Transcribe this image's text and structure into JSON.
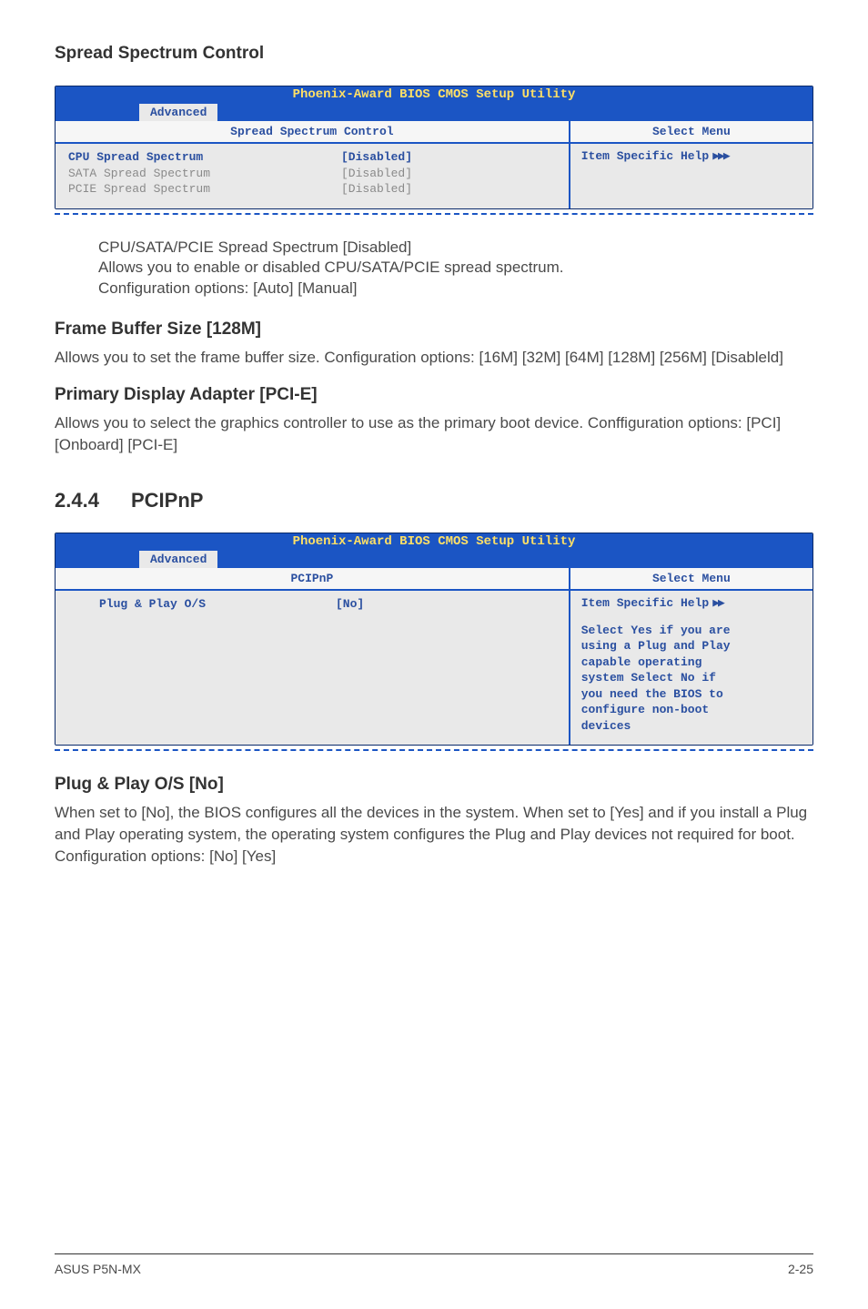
{
  "sections": {
    "spread_spectrum_control": {
      "heading": "Spread Spectrum Control"
    },
    "frame_buffer": {
      "heading": "Frame Buffer Size [128M]",
      "body": "Allows you to set the frame buffer size. Configuration options: [16M] [32M] [64M] [128M] [256M] [Disableld]"
    },
    "primary_display": {
      "heading": "Primary Display Adapter [PCI-E]",
      "body": "Allows you to select the graphics controller to use as the primary boot device. Conffiguration options: [PCI] [Onboard] [PCI-E]"
    },
    "pcipnp_heading": {
      "num": "2.4.4",
      "title": "PCIPnP"
    },
    "plug_play": {
      "heading": "Plug & Play O/S [No]",
      "body": "When set to [No], the BIOS configures all the devices in the system. When set to [Yes] and if you install a Plug and Play operating system, the operating system configures the Plug and Play devices not required for boot.\nConfiguration options: [No] [Yes]"
    }
  },
  "indent": {
    "title": "CPU/SATA/PCIE Spread Spectrum [Disabled]",
    "line1": "Allows you to enable or disabled CPU/SATA/PCIE spread spectrum.",
    "line2": "Configuration options: [Auto] [Manual]"
  },
  "bios1": {
    "title": "Phoenix-Award BIOS CMOS Setup Utility",
    "tab": "Advanced",
    "subhead_left": "Spread Spectrum Control",
    "subhead_right": "Select Menu",
    "rows": [
      {
        "label": "CPU Spread Spectrum",
        "value": "[Disabled]",
        "style": "bold"
      },
      {
        "label": "SATA Spread Spectrum",
        "value": "[Disabled]",
        "style": "muted"
      },
      {
        "label": "PCIE Spread Spectrum",
        "value": "[Disabled]",
        "style": "muted"
      }
    ],
    "help_label": "Item Specific Help",
    "help_arrows": "▶▶▶"
  },
  "bios2": {
    "title": "Phoenix-Award BIOS CMOS Setup Utility",
    "tab": "Advanced",
    "subhead_left": "PCIPnP",
    "subhead_right": "Select Menu",
    "rows": [
      {
        "label": "Plug & Play O/S",
        "value": "[No]",
        "style": "bold"
      }
    ],
    "help_label": "Item Specific Help",
    "help_arrows": "▶▶",
    "help_lines": [
      "Select Yes if you are",
      "using a Plug and Play",
      "capable operating",
      "system  Select No if",
      "you need the BIOS to",
      "configure non-boot",
      "devices"
    ]
  },
  "footer": {
    "left": "ASUS P5N-MX",
    "right": "2-25"
  }
}
